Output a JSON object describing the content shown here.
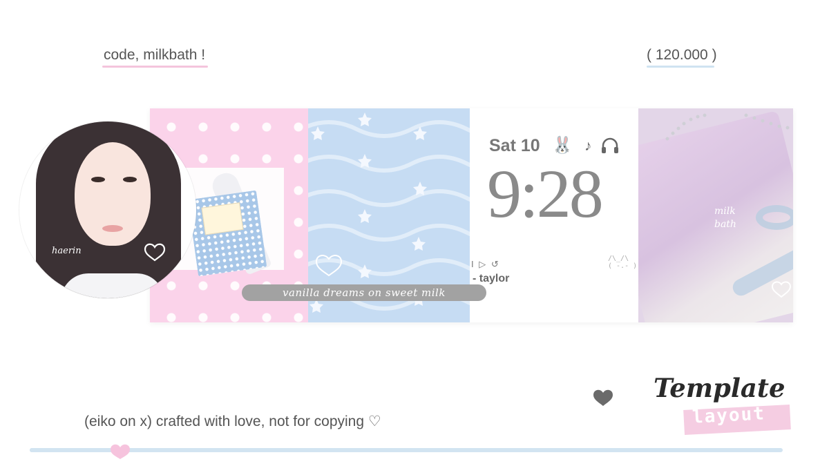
{
  "header": {
    "left_text": "code, milkbath !",
    "right_text": "( 120.000 )"
  },
  "avatar": {
    "name_caption": "haerin",
    "icon": "heart-outline-icon"
  },
  "lockscreen": {
    "date": "Sat 10",
    "icons": [
      "bunny-icon",
      "music-note-icon",
      "headphones-icon"
    ],
    "bunny_glyph": "🐰",
    "note_glyph": "♪",
    "time": "9:28",
    "controls": "I ▷ ↺",
    "artist": "- taylor",
    "cat_art": "/\\_/\\\n( -.- )",
    "song_pill": "vanilla dreams on sweet milk"
  },
  "lilac_panel": {
    "caption": [
      "milk",
      "bath"
    ]
  },
  "footer": {
    "credit": "(eiko on x) crafted with love, not for copying ♡"
  },
  "badge": {
    "title": "Template",
    "subtitle": "layout"
  },
  "slider": {
    "value_fraction": 0.12
  },
  "colors": {
    "pink": "#fbd3ea",
    "baby_blue": "#c6dcf3",
    "lilac": "#e3d6e8",
    "pill_grey": "#a2a2a2",
    "slider_track": "#d2e4f1"
  }
}
